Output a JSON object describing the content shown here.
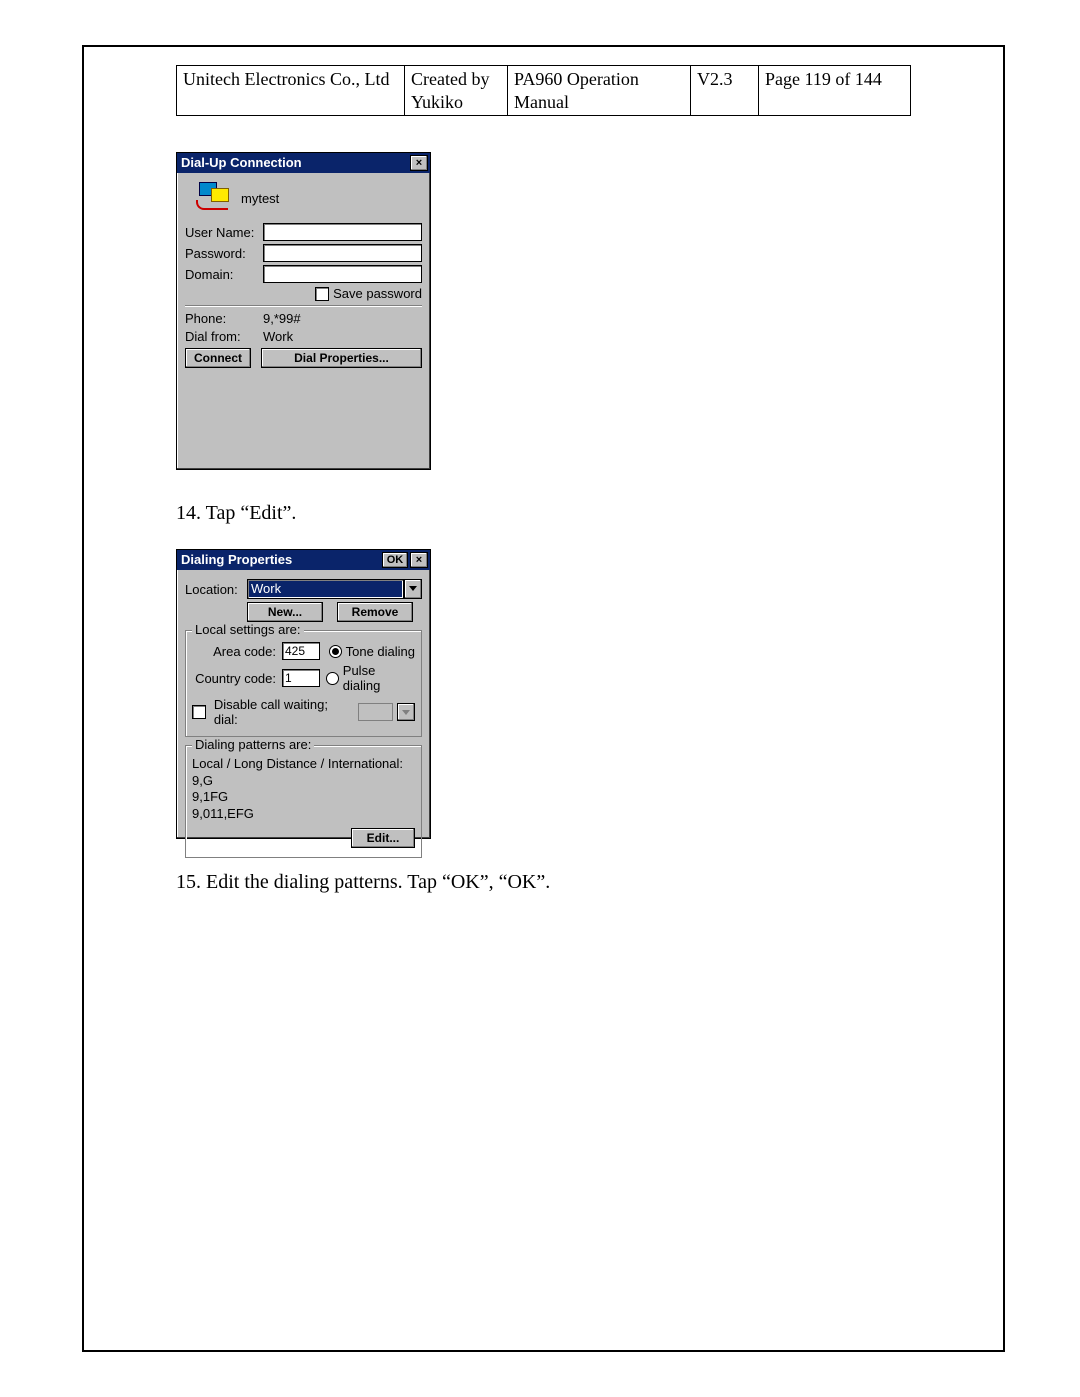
{
  "header": {
    "company": "Unitech Electronics Co., Ltd",
    "created": "Created by Yukiko",
    "doc": "PA960 Operation Manual",
    "version": "V2.3",
    "page": "Page 119 of 144"
  },
  "dlg1": {
    "title": "Dial-Up Connection",
    "close": "×",
    "conn_name": "mytest",
    "user_label": "User Name:",
    "user_value": "",
    "pass_label": "Password:",
    "pass_value": "",
    "domain_label": "Domain:",
    "domain_value": "",
    "save_pwd": "Save password",
    "phone_label": "Phone:",
    "phone_value": "9,*99#",
    "dialfrom_label": "Dial from:",
    "dialfrom_value": "Work",
    "connect_btn": "Connect",
    "dialprops_btn": "Dial Properties..."
  },
  "step14": "14. Tap “Edit”.",
  "dlg2": {
    "title": "Dialing Properties",
    "ok": "OK",
    "close": "×",
    "location_label": "Location:",
    "location_value": "Work",
    "new_btn": "New...",
    "remove_btn": "Remove",
    "local_settings_legend": "Local settings are:",
    "areacode_label": "Area code:",
    "areacode_value": "425",
    "countrycode_label": "Country code:",
    "countrycode_value": "1",
    "tone_label": "Tone dialing",
    "pulse_label": "Pulse dialing",
    "disable_cw": "Disable call waiting;  dial:",
    "patterns_legend": "Dialing patterns are:",
    "patterns_sub": "Local / Long Distance / International:",
    "pattern1": "9,G",
    "pattern2": "9,1FG",
    "pattern3": "9,011,EFG",
    "edit_btn": "Edit..."
  },
  "step15": "15. Edit the dialing patterns. Tap “OK”, “OK”."
}
